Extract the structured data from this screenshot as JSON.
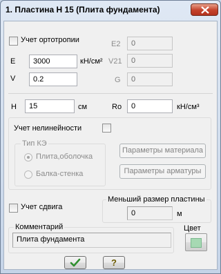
{
  "window": {
    "title": "1. Пластина  Н 15 (Плита фундамента)"
  },
  "orthotropy": {
    "label": "Учет ортотропии",
    "checked": false,
    "E_label": "E",
    "E_value": "3000",
    "E_unit": "кН/см²",
    "V_label": "V",
    "V_value": "0.2",
    "E2_label": "E2",
    "E2_value": "0",
    "V21_label": "V21",
    "V21_value": "0",
    "G_label": "G",
    "G_value": "0"
  },
  "thickness": {
    "H_label": "H",
    "H_value": "15",
    "H_unit": "см",
    "Ro_label": "Ro",
    "Ro_value": "0",
    "Ro_unit": "кН/см³"
  },
  "nonlinearity": {
    "label": "Учет нелинейности",
    "checked": false,
    "ke_type_title": "Тип КЭ",
    "options": [
      "Плита,оболочка",
      "Балка-стенка"
    ],
    "selected_option": "Плита,оболочка",
    "material_button": "Параметры материала",
    "reinforcement_button": "Параметры арматуры"
  },
  "shear": {
    "label": "Учет сдвига",
    "checked": false,
    "min_size_title": "Меньший размер пластины",
    "min_size_value": "0",
    "min_size_unit": "м"
  },
  "comment": {
    "title": "Комментарий",
    "value": "Плита фундамента"
  },
  "color": {
    "title": "Цвет",
    "value": "#a6d9b3"
  },
  "footer": {
    "ok_icon": "checkmark-icon",
    "help_label": "?"
  }
}
